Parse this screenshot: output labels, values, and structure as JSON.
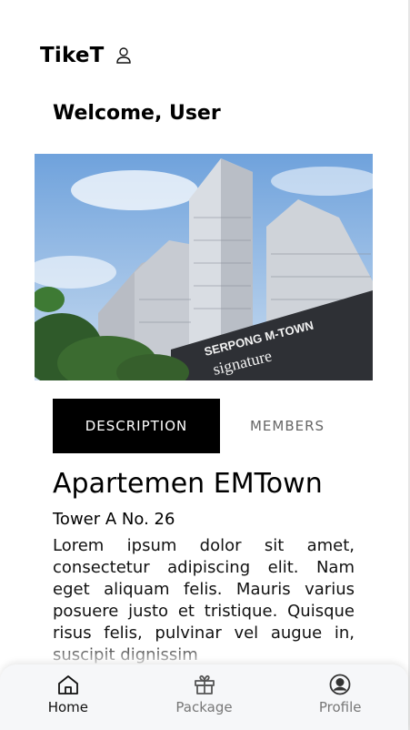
{
  "header": {
    "brand": "TikeT",
    "user_icon": "user-icon"
  },
  "welcome": "Welcome, User",
  "hero": {
    "signage_line1": "SERPONG M-TOWN",
    "signage_line2": "signature"
  },
  "tabs": [
    {
      "label": "DESCRIPTION",
      "active": true
    },
    {
      "label": "MEMBERS",
      "active": false
    }
  ],
  "property": {
    "name": "Apartemen EMTown",
    "unit": "Tower A No. 26",
    "description": "Lorem ipsum dolor sit amet, consectetur adipiscing elit. Nam eget aliquam felis. Mauris varius posuere justo et tristique. Quisque risus felis, pulvinar vel augue in, suscipit dignissim"
  },
  "bottom_nav": [
    {
      "label": "Home",
      "icon": "home-icon",
      "active": true
    },
    {
      "label": "Package",
      "icon": "gift-icon",
      "active": false
    },
    {
      "label": "Profile",
      "icon": "profile-icon",
      "active": false
    }
  ],
  "colors": {
    "active_tab_bg": "#000000",
    "nav_bg": "#f6f7f9",
    "sky": "#8fb8e4"
  }
}
